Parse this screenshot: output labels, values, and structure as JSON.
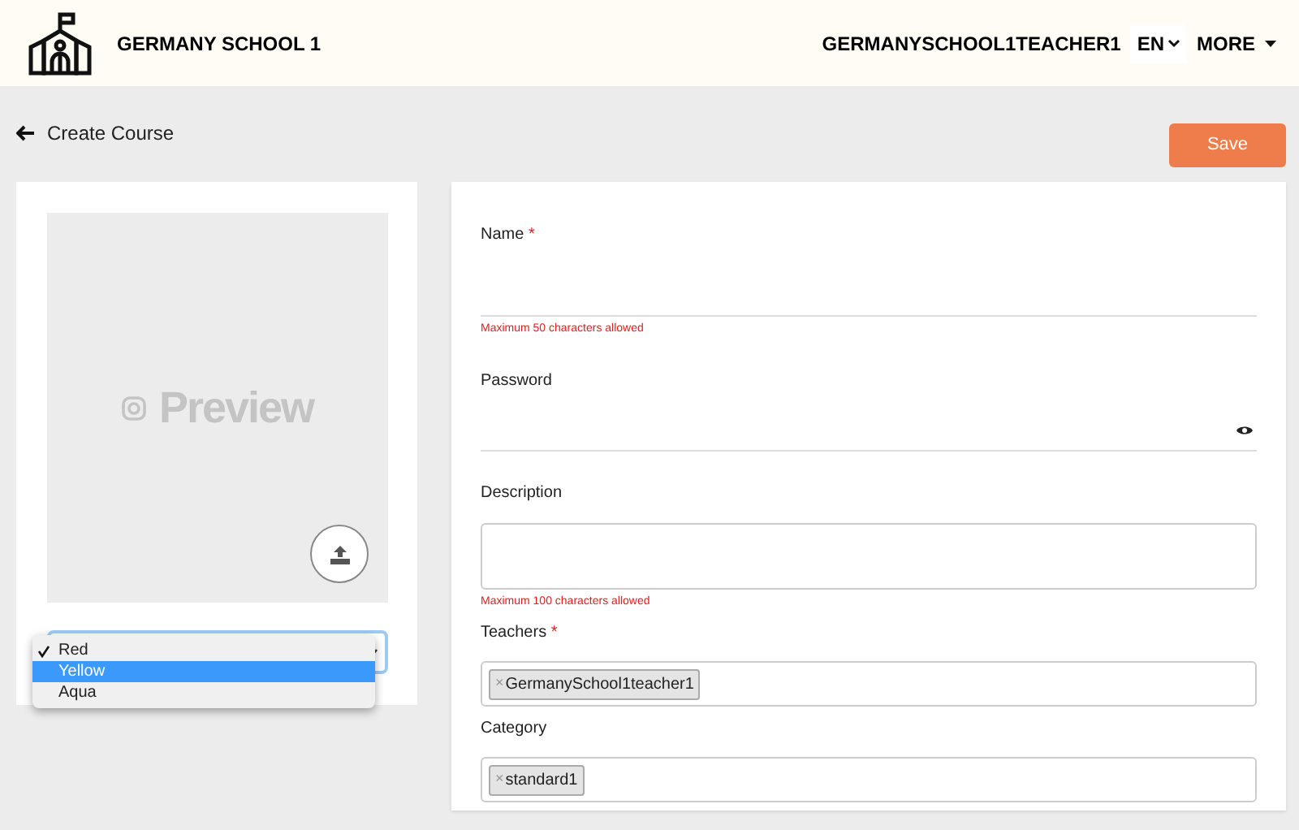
{
  "header": {
    "school_name": "GERMANY SCHOOL 1",
    "user": "GERMANYSCHOOL1TEACHER1",
    "language": "EN",
    "more": "MORE"
  },
  "page": {
    "title": "Create Course",
    "save_button": "Save"
  },
  "preview": {
    "label": "Preview"
  },
  "color_dropdown": {
    "open": true,
    "options": [
      {
        "label": "Red",
        "checked": true,
        "highlighted": false
      },
      {
        "label": "Yellow",
        "checked": false,
        "highlighted": true
      },
      {
        "label": "Aqua",
        "checked": false,
        "highlighted": false
      }
    ]
  },
  "form": {
    "fields": [
      {
        "kind": "text",
        "label": "Name",
        "required_mark": "*",
        "hint": "Maximum 50 characters allowed"
      },
      {
        "kind": "password",
        "label": "Password"
      },
      {
        "kind": "textarea",
        "label": "Description",
        "hint": "Maximum 100 characters allowed"
      },
      {
        "kind": "tags",
        "label": "Teachers",
        "required_mark": "*",
        "tags": [
          {
            "label": "GermanySchool1teacher1",
            "remove": "×"
          }
        ]
      },
      {
        "kind": "tags",
        "label": "Category",
        "tags": [
          {
            "label": "standard1",
            "remove": "×"
          }
        ]
      }
    ]
  }
}
